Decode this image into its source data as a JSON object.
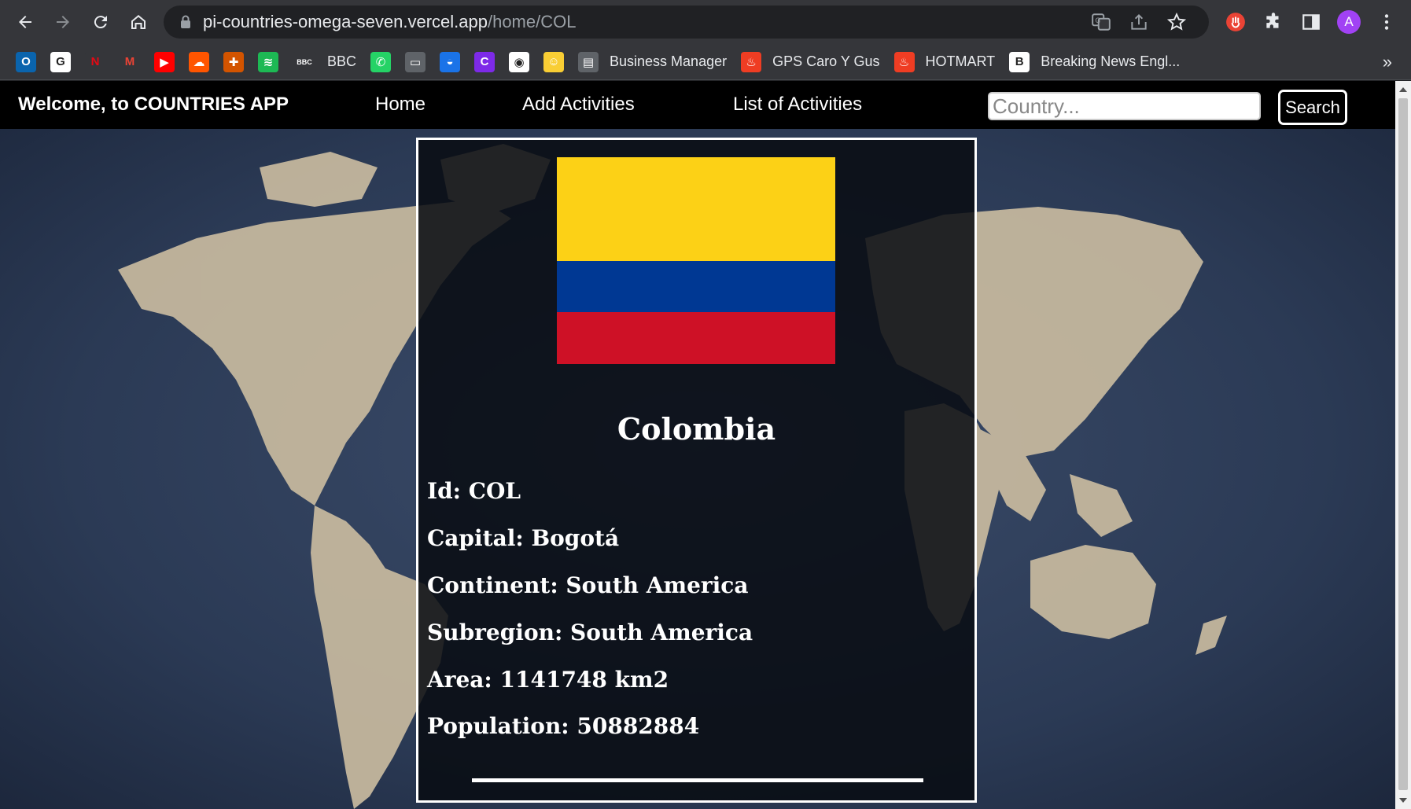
{
  "browser": {
    "url_host": "pi-countries-omega-seven.vercel.app",
    "url_path": "/home/COL",
    "profile_initial": "A",
    "nav_icons": [
      "back-arrow-icon",
      "forward-arrow-icon",
      "reload-icon",
      "home-icon"
    ],
    "omnibox_icons": [
      "translate-icon",
      "share-icon",
      "star-icon"
    ],
    "toolbar_icons": [
      "extension-red-icon",
      "puzzle-icon",
      "side-panel-icon",
      "kebab-menu-icon"
    ]
  },
  "bookmarks": {
    "items": [
      {
        "icon": "outlook-icon",
        "label": "",
        "color": "#0a64ad",
        "glyph": "O"
      },
      {
        "icon": "google-icon",
        "label": "",
        "color": "#ffffff",
        "glyph": "G"
      },
      {
        "icon": "netflix-icon",
        "label": "",
        "color": "#35363a",
        "glyph": "N"
      },
      {
        "icon": "gmail-icon",
        "label": "",
        "color": "#35363a",
        "glyph": "M"
      },
      {
        "icon": "youtube-icon",
        "label": "",
        "color": "#ff0000",
        "glyph": "▶"
      },
      {
        "icon": "soundcloud-icon",
        "label": "",
        "color": "#ff5500",
        "glyph": "☁"
      },
      {
        "icon": "shield-crest-icon",
        "label": "",
        "color": "#d35400",
        "glyph": "✚"
      },
      {
        "icon": "spotify-icon",
        "label": "",
        "color": "#1db954",
        "glyph": "≋"
      },
      {
        "icon": "bbc-icon",
        "label": "BBC",
        "color": "#35363a",
        "glyph": "BBC"
      },
      {
        "icon": "whatsapp-icon",
        "label": "",
        "color": "#25d366",
        "glyph": "✆"
      },
      {
        "icon": "folder-icon",
        "label": "",
        "color": "#5f6368",
        "glyph": "▭"
      },
      {
        "icon": "app-blue-icon",
        "label": "",
        "color": "#1a73e8",
        "glyph": "◒"
      },
      {
        "icon": "canva-icon",
        "label": "",
        "color": "#7d2ae8",
        "glyph": "C"
      },
      {
        "icon": "panda-icon",
        "label": "",
        "color": "#ffffff",
        "glyph": "◉"
      },
      {
        "icon": "emoji-icon",
        "label": "",
        "color": "#f9ce34",
        "glyph": "☺"
      },
      {
        "icon": "business-manager-icon",
        "label": "Business Manager",
        "color": "#5f6368",
        "glyph": "▤"
      },
      {
        "icon": "flame-icon",
        "label": "GPS Caro Y Gus",
        "color": "#ef3d23",
        "glyph": "♨"
      },
      {
        "icon": "flame-icon",
        "label": "HOTMART",
        "color": "#ef3d23",
        "glyph": "♨"
      },
      {
        "icon": "breaking-news-icon",
        "label": "Breaking News Engl...",
        "color": "#ffffff",
        "glyph": "B"
      }
    ],
    "more": "»"
  },
  "app": {
    "brand": "Welcome, to COUNTRIES APP",
    "nav": {
      "home": "Home",
      "add_activities": "Add Activities",
      "list_activities": "List of Activities"
    },
    "search": {
      "placeholder": "Country...",
      "value": "",
      "button_label": "Search"
    }
  },
  "country": {
    "name": "Colombia",
    "flag_colors": [
      "#fcd116",
      "#003893",
      "#ce1126"
    ],
    "id_line": "Id: COL",
    "capital_line": "Capital: Bogotá",
    "continent_line": "Continent: South America",
    "subregion_line": "Subregion: South America",
    "area_line": "Area: 1141748 km2",
    "population_line": "Population: 50882884"
  }
}
